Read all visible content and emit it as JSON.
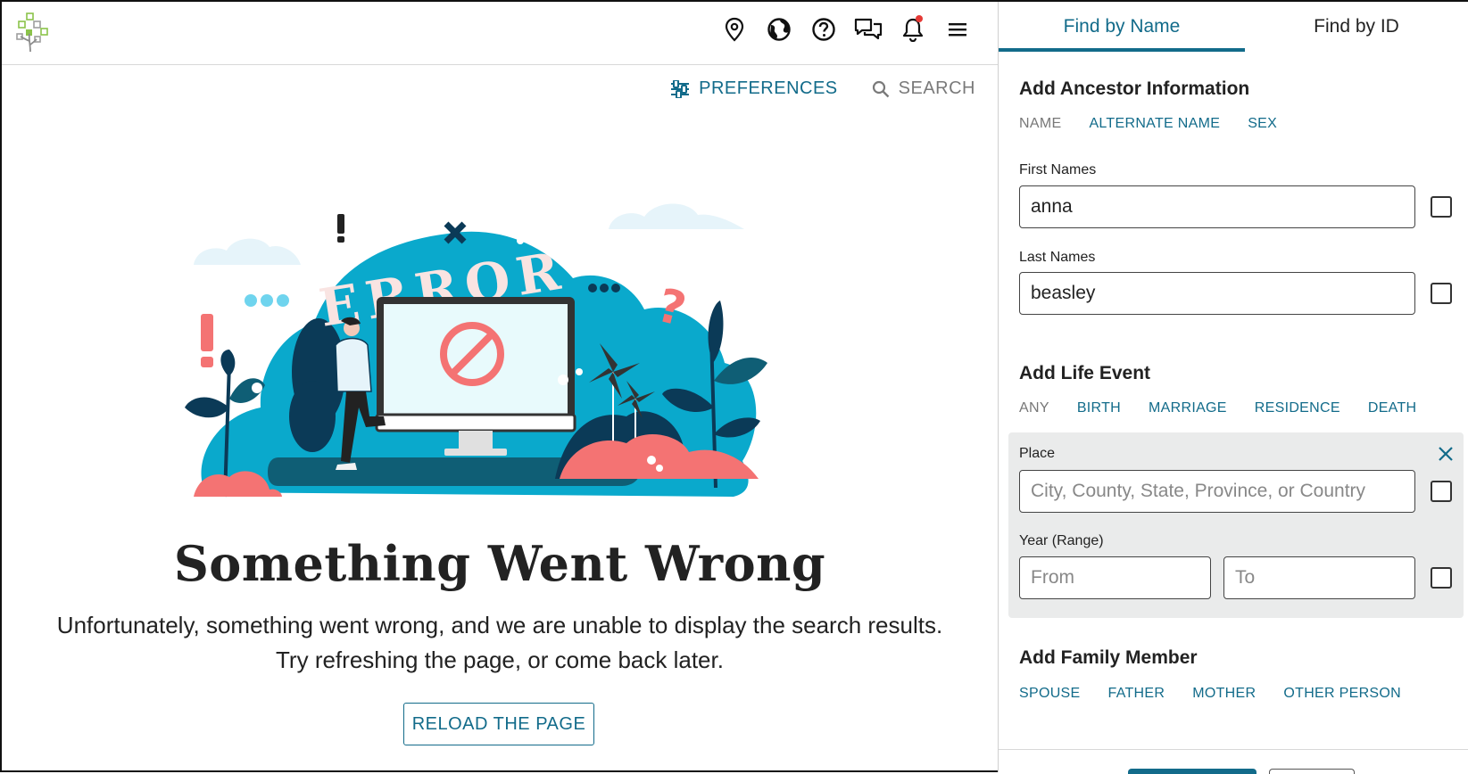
{
  "header": {
    "logo_icon": "family-tree-logo-icon",
    "icons": [
      "location-pin-icon",
      "globe-icon",
      "help-icon",
      "messages-icon",
      "bell-icon",
      "menu-icon"
    ]
  },
  "toolbar": {
    "preferences_label": "PREFERENCES",
    "search_label": "SEARCH"
  },
  "error": {
    "illustration_text": "ERROR",
    "title": "Something Went Wrong",
    "message_line1": "Unfortunately, something went wrong, and we are unable to display the search results.",
    "message_line2": "Try refreshing the page, or come back later.",
    "reload_label": "RELOAD THE PAGE"
  },
  "panel": {
    "tabs": [
      {
        "label": "Find by Name",
        "active": true
      },
      {
        "label": "Find by ID",
        "active": false
      }
    ],
    "ancestor": {
      "heading": "Add Ancestor Information",
      "chips": [
        "NAME",
        "ALTERNATE NAME",
        "SEX"
      ],
      "first_names_label": "First Names",
      "first_names_value": "anna",
      "last_names_label": "Last Names",
      "last_names_value": "beasley"
    },
    "life_event": {
      "heading": "Add Life Event",
      "chips": [
        "ANY",
        "BIRTH",
        "MARRIAGE",
        "RESIDENCE",
        "DEATH"
      ],
      "place_label": "Place",
      "place_placeholder": "City, County, State, Province, or Country",
      "year_label": "Year (Range)",
      "from_placeholder": "From",
      "to_placeholder": "To"
    },
    "family": {
      "heading": "Add Family Member",
      "chips": [
        "SPOUSE",
        "FATHER",
        "MOTHER",
        "OTHER PERSON"
      ]
    }
  },
  "colors": {
    "accent": "#126b8a",
    "illustration_blue": "#0aa9cc",
    "illustration_dark": "#0b3a57",
    "illustration_coral": "#f47373",
    "notification": "#e53935"
  }
}
